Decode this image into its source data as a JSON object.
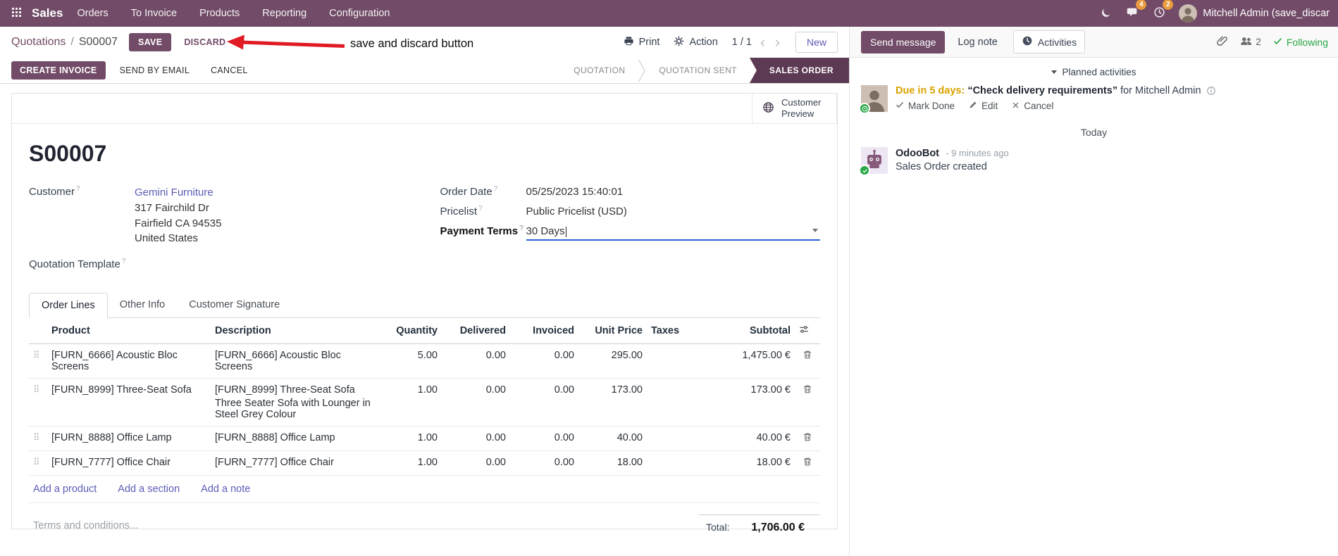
{
  "colors": {
    "brand": "#714B67",
    "active_step_bg": "#5d3a53",
    "link": "#5d5bb5",
    "edited_value": "#2b64d4",
    "warning_text": "#d9a300",
    "success": "#28a745",
    "badge": "#e89a3c",
    "annotation_arrow": "#e01b24"
  },
  "navbar": {
    "app_name": "Sales",
    "menu": [
      "Orders",
      "To Invoice",
      "Products",
      "Reporting",
      "Configuration"
    ],
    "message_badge": "4",
    "activity_badge": "2",
    "user_name": "Mitchell Admin (save_discar"
  },
  "control_panel": {
    "breadcrumb_parent": "Quotations",
    "breadcrumb_separator": "/",
    "breadcrumb_current": "S00007",
    "save_label": "SAVE",
    "discard_label": "DISCARD",
    "print_label": "Print",
    "action_label": "Action",
    "pager_value": "1 / 1",
    "new_label": "New"
  },
  "annotation": {
    "text": "save and discard button"
  },
  "statusbar": {
    "create_invoice_label": "CREATE INVOICE",
    "send_by_email_label": "SEND BY EMAIL",
    "cancel_label": "CANCEL",
    "steps": [
      {
        "label": "QUOTATION",
        "active": false
      },
      {
        "label": "QUOTATION SENT",
        "active": false
      },
      {
        "label": "SALES ORDER",
        "active": true
      }
    ]
  },
  "sheet": {
    "customer_preview_label": "Customer Preview",
    "title": "S00007",
    "help_symbol": "?",
    "fields": {
      "customer_label": "Customer",
      "customer_name": "Gemini Furniture",
      "address_line1": "317 Fairchild Dr",
      "address_line2": "Fairfield CA 94535",
      "address_line3": "United States",
      "quotation_template_label": "Quotation Template",
      "order_date_label": "Order Date",
      "order_date_value": "05/25/2023 15:40:01",
      "pricelist_label": "Pricelist",
      "pricelist_value": "Public Pricelist (USD)",
      "payment_terms_label": "Payment Terms",
      "payment_terms_value": "30 Days"
    },
    "tabs": [
      "Order Lines",
      "Other Info",
      "Customer Signature"
    ],
    "order_lines": {
      "columns": [
        "Product",
        "Description",
        "Quantity",
        "Delivered",
        "Invoiced",
        "Unit Price",
        "Taxes",
        "Subtotal"
      ],
      "rows": [
        {
          "product": "[FURN_6666] Acoustic Bloc Screens",
          "desc1": "[FURN_6666] Acoustic Bloc Screens",
          "desc2": "",
          "quantity": "5.00",
          "delivered": "0.00",
          "invoiced": "0.00",
          "unit_price": "295.00",
          "taxes": "",
          "subtotal": "1,475.00 €"
        },
        {
          "product": "[FURN_8999] Three-Seat Sofa",
          "desc1": "[FURN_8999] Three-Seat Sofa",
          "desc2": "Three Seater Sofa with Lounger in Steel Grey Colour",
          "quantity": "1.00",
          "delivered": "0.00",
          "invoiced": "0.00",
          "unit_price": "173.00",
          "taxes": "",
          "subtotal": "173.00 €"
        },
        {
          "product": "[FURN_8888] Office Lamp",
          "desc1": "[FURN_8888] Office Lamp",
          "desc2": "",
          "quantity": "1.00",
          "delivered": "0.00",
          "invoiced": "0.00",
          "unit_price": "40.00",
          "taxes": "",
          "subtotal": "40.00 €"
        },
        {
          "product": "[FURN_7777] Office Chair",
          "desc1": "[FURN_7777] Office Chair",
          "desc2": "",
          "quantity": "1.00",
          "delivered": "0.00",
          "invoiced": "0.00",
          "unit_price": "18.00",
          "taxes": "",
          "subtotal": "18.00 €"
        }
      ],
      "add_product_label": "Add a product",
      "add_section_label": "Add a section",
      "add_note_label": "Add a note"
    },
    "terms_placeholder": "Terms and conditions...",
    "total_label": "Total:",
    "total_value": "1,706.00 €"
  },
  "chatter": {
    "send_message_label": "Send message",
    "log_note_label": "Log note",
    "activities_label": "Activities",
    "followers_count": "2",
    "following_label": "Following",
    "planned_activities_label": "Planned activities",
    "activity": {
      "due_text": "Due in 5 days:",
      "summary": "“Check delivery requirements”",
      "assignee_text": "for Mitchell Admin",
      "mark_done_label": "Mark Done",
      "edit_label": "Edit",
      "cancel_label": "Cancel"
    },
    "date_separator": "Today",
    "message": {
      "author": "OdooBot",
      "time": "- 9 minutes ago",
      "body": "Sales Order created"
    }
  },
  "icons": {
    "drag_handle": "⠿",
    "pager_previous": "‹",
    "pager_next": "›"
  }
}
